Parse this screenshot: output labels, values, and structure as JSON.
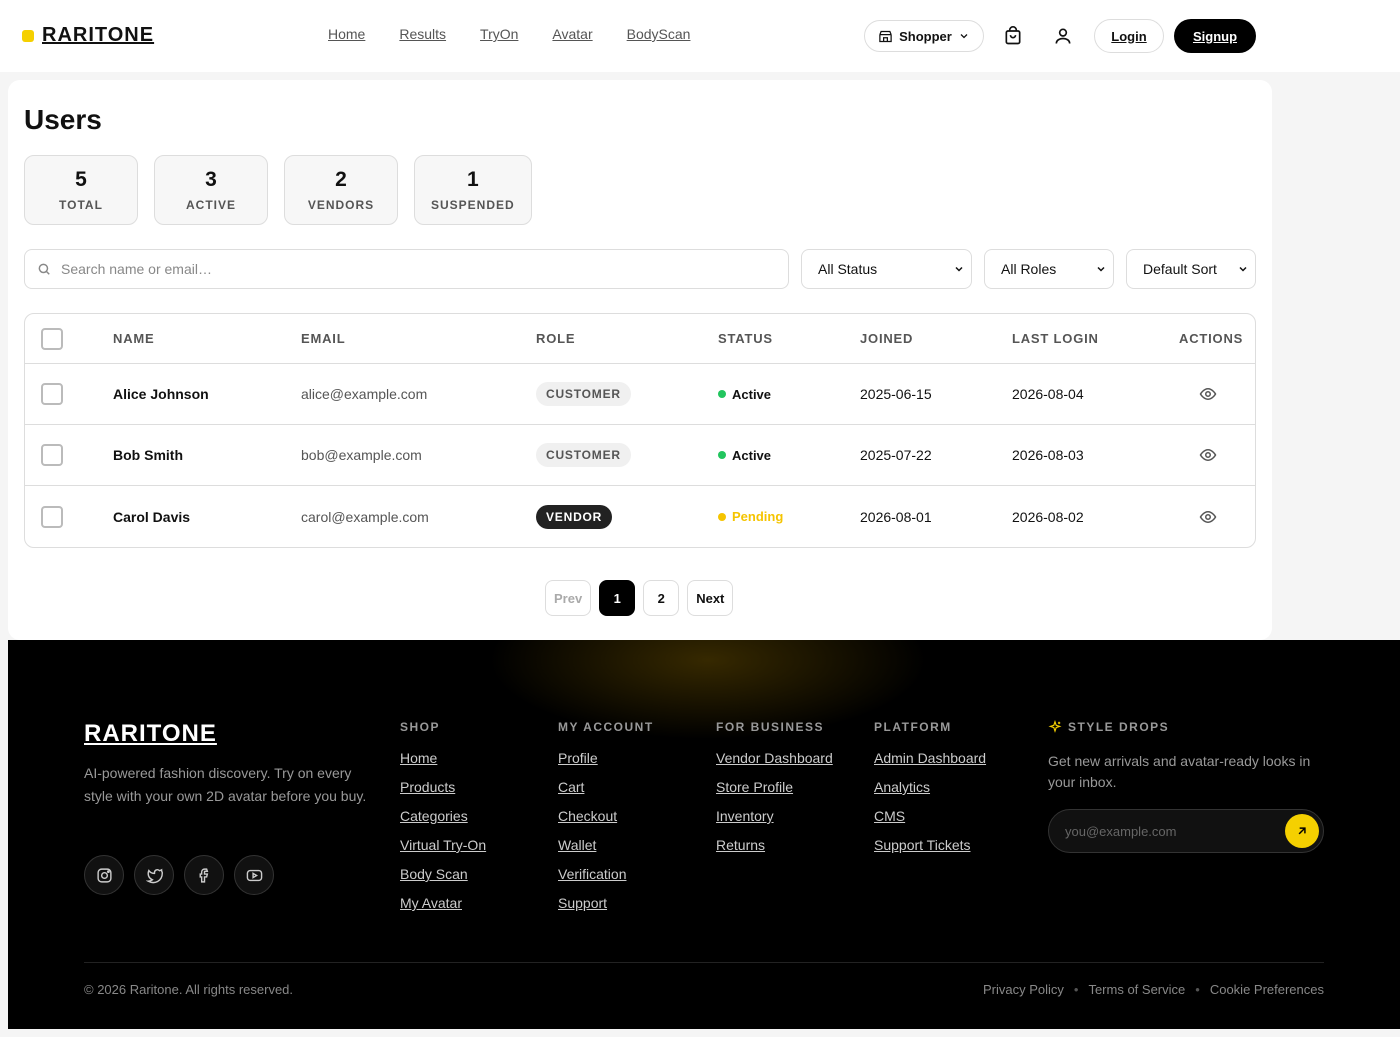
{
  "header": {
    "brand": "RARITONE",
    "nav": [
      "Home",
      "Results",
      "TryOn",
      "Avatar",
      "BodyScan"
    ],
    "role_label": "Shopper",
    "login_label": "Login",
    "signup_label": "Signup"
  },
  "page": {
    "title": "Users",
    "stats": [
      {
        "value": "5",
        "label": "TOTAL"
      },
      {
        "value": "3",
        "label": "ACTIVE"
      },
      {
        "value": "2",
        "label": "VENDORS"
      },
      {
        "value": "1",
        "label": "SUSPENDED"
      }
    ],
    "search_placeholder": "Search name or email…",
    "filters": {
      "status": "All Status",
      "roles": "All Roles",
      "sort": "Default Sort"
    }
  },
  "table": {
    "headers": [
      "NAME",
      "EMAIL",
      "ROLE",
      "STATUS",
      "JOINED",
      "LAST LOGIN",
      "ACTIONS"
    ],
    "rows": [
      {
        "name": "Alice Johnson",
        "email": "alice@example.com",
        "role": "CUSTOMER",
        "status": "Active",
        "joined": "2025-06-15",
        "last_login": "2026-08-04"
      },
      {
        "name": "Bob Smith",
        "email": "bob@example.com",
        "role": "CUSTOMER",
        "status": "Active",
        "joined": "2025-07-22",
        "last_login": "2026-08-03"
      },
      {
        "name": "Carol Davis",
        "email": "carol@example.com",
        "role": "VENDOR",
        "status": "Pending",
        "joined": "2026-08-01",
        "last_login": "2026-08-02"
      }
    ]
  },
  "pagination": {
    "prev": "Prev",
    "pages": [
      "1",
      "2"
    ],
    "next": "Next"
  },
  "footer": {
    "brand": "RARITONE",
    "tagline": "AI-powered fashion discovery. Try on every style with your own 2D avatar before you buy.",
    "columns": [
      {
        "title": "SHOP",
        "links": [
          "Home",
          "Products",
          "Categories",
          "Virtual Try-On",
          "Body Scan",
          "My Avatar"
        ]
      },
      {
        "title": "MY ACCOUNT",
        "links": [
          "Profile",
          "Cart",
          "Checkout",
          "Wallet",
          "Verification",
          "Support"
        ]
      },
      {
        "title": "FOR BUSINESS",
        "links": [
          "Vendor Dashboard",
          "Store Profile",
          "Inventory",
          "Returns"
        ]
      },
      {
        "title": "PLATFORM",
        "links": [
          "Admin Dashboard",
          "Analytics",
          "CMS",
          "Support Tickets"
        ]
      }
    ],
    "newsletter": {
      "title": "STYLE DROPS",
      "text": "Get new arrivals and avatar-ready looks in your inbox.",
      "placeholder": "you@example.com"
    },
    "copyright": "© 2026 Raritone. All rights reserved.",
    "legal": [
      "Privacy Policy",
      "Terms of Service",
      "Cookie Preferences"
    ]
  },
  "colors": {
    "accent": "#f5d000",
    "active": "#22c55e",
    "pending": "#f5c400"
  }
}
